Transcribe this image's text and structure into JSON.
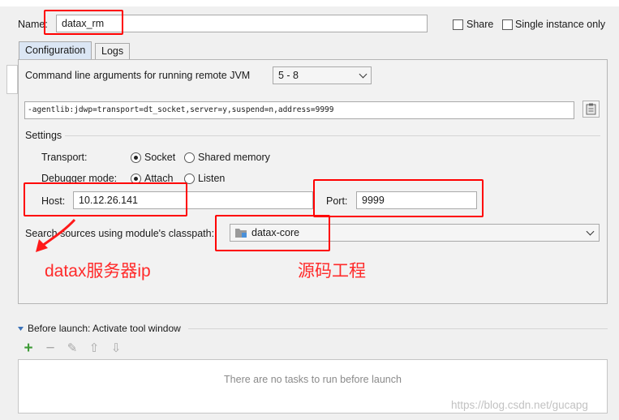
{
  "name_label": "Name:",
  "name_value": "datax_rm",
  "share_label": "Share",
  "single_instance_label": "Single instance only",
  "tabs": [
    "Configuration",
    "Logs"
  ],
  "cmd_label": "Command line arguments for running remote JVM",
  "jvm_version": "5 - 8",
  "cmd_args": "-agentlib:jdwp=transport=dt_socket,server=y,suspend=n,address=9999",
  "settings_label": "Settings",
  "transport_label": "Transport:",
  "transport_options": [
    "Socket",
    "Shared memory"
  ],
  "transport_selected": "Socket",
  "debugger_mode_label": "Debugger mode:",
  "debugger_mode_options": [
    "Attach",
    "Listen"
  ],
  "debugger_mode_selected": "Attach",
  "host_label": "Host:",
  "host_value": "10.12.26.141",
  "port_label": "Port:",
  "port_value": "9999",
  "classpath_label": "Search sources using module's classpath:",
  "classpath_module": "datax-core",
  "annotation_host": "datax服务器ip",
  "annotation_module": "源码工程",
  "before_launch_label": "Before launch: Activate tool window",
  "toolbar_icons": [
    "add-icon",
    "remove-icon",
    "edit-icon",
    "move-up-icon",
    "move-down-icon"
  ],
  "empty_tasks_text": "There are no tasks to run before launch",
  "watermark": "https://blog.csdn.net/gucapg",
  "colors": {
    "annotation_red": "#ff0000",
    "add_green": "#3d9a36",
    "tab_selected": "#dbe6f4"
  }
}
